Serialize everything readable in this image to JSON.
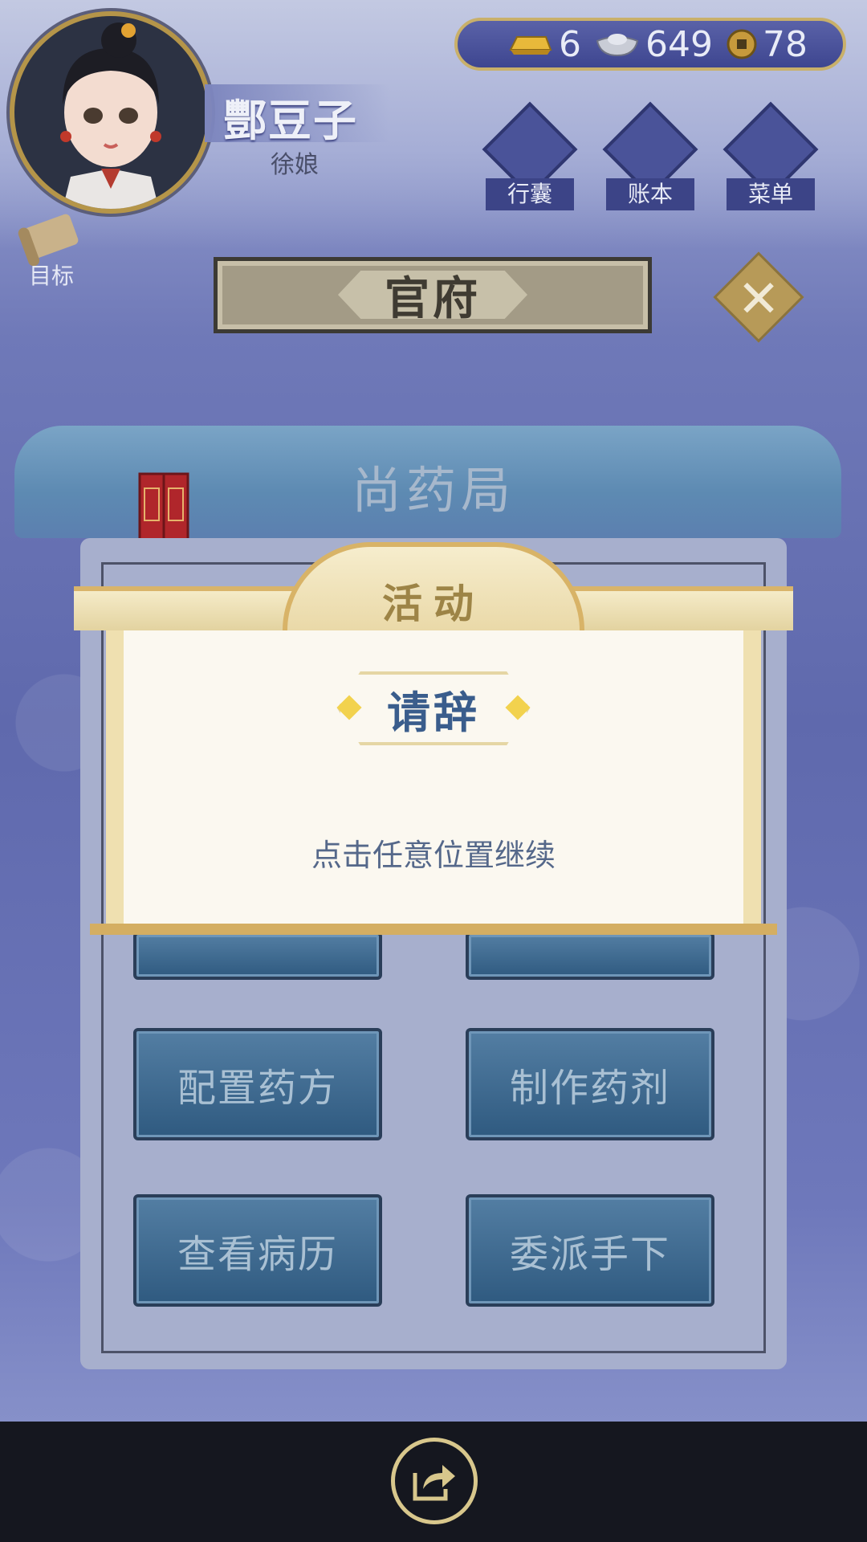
{
  "player": {
    "name": "酆豆子",
    "rank": "徐娘"
  },
  "currency": {
    "gold": "6",
    "silver": "649",
    "coins": "78"
  },
  "hud": {
    "bag_label": "行囊",
    "ledger_label": "账本",
    "menu_label": "菜单",
    "goal_label": "目标"
  },
  "location": {
    "title": "官府",
    "department": "尚药局"
  },
  "actions": [
    {
      "label": "配置药方"
    },
    {
      "label": "制作药剂"
    },
    {
      "label": "查看病历"
    },
    {
      "label": "委派手下"
    }
  ],
  "modal": {
    "header": "活动",
    "tag": "请辞",
    "continue_text": "点击任意位置继续"
  },
  "colors": {
    "accent_gold": "#d8b367",
    "panel_blue": "#3a5d8c",
    "background": "#6f79b8"
  },
  "icons": [
    "gold-ingot-icon",
    "silver-ingot-icon",
    "coin-icon",
    "bag-icon",
    "ledger-icon",
    "menu-icon",
    "scroll-icon",
    "close-icon",
    "share-icon"
  ]
}
